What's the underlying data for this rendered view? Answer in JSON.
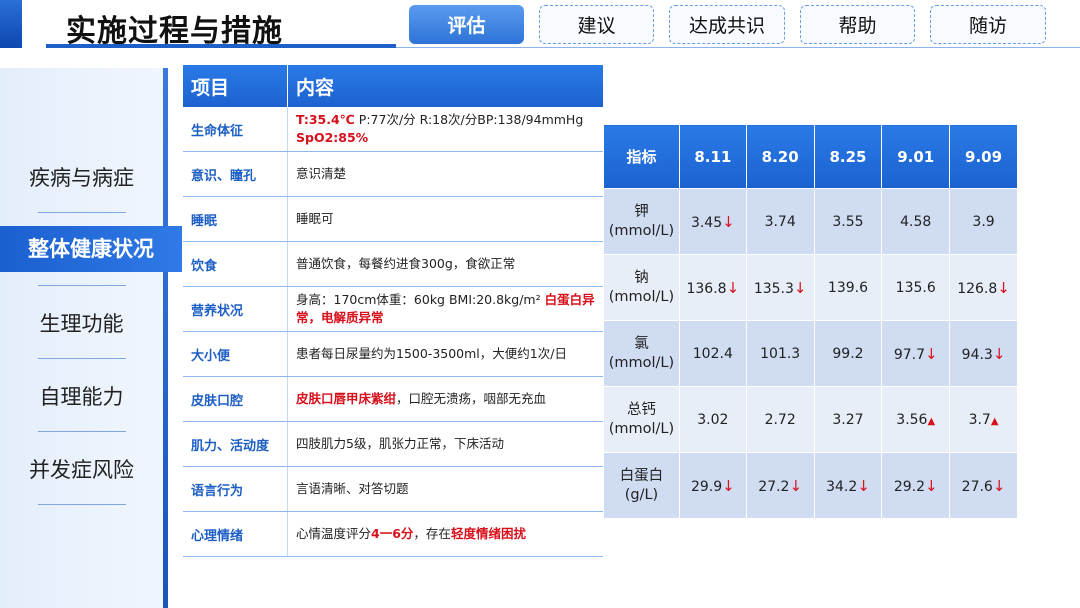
{
  "header": {
    "title": "实施过程与措施",
    "tabs": [
      "评估",
      "建议",
      "达成共识",
      "帮助",
      "随访"
    ],
    "active_tab": "评估"
  },
  "sidebar": {
    "items": [
      "疾病与病症",
      "整体健康状况",
      "生理功能",
      "自理能力",
      "并发症风险"
    ],
    "active_item": "整体健康状况"
  },
  "left_table": {
    "headers": [
      "项目",
      "内容"
    ],
    "rows": [
      {
        "label": "生命体征",
        "parts": [
          {
            "t": "T:35.4℃",
            "r": true
          },
          {
            "t": " P:77次/分 R:18次/分BP:138/94mmHg ",
            "r": false
          },
          {
            "t": "SpO2:85%",
            "r": true
          }
        ]
      },
      {
        "label": "意识、瞳孔",
        "parts": [
          {
            "t": "意识清楚",
            "r": false
          }
        ]
      },
      {
        "label": "睡眠",
        "parts": [
          {
            "t": "睡眠可",
            "r": false
          }
        ]
      },
      {
        "label": "饮食",
        "parts": [
          {
            "t": "普通饮食，每餐约进食300g，食欲正常",
            "r": false
          }
        ]
      },
      {
        "label": "营养状况",
        "parts": [
          {
            "t": "身高：170cm体重：60kg BMI:20.8kg/m² ",
            "r": false
          },
          {
            "t": "白蛋白异常，电解质异常",
            "r": true
          }
        ]
      },
      {
        "label": "大小便",
        "parts": [
          {
            "t": "患者每日尿量约为1500-3500ml，大便约1次/日",
            "r": false
          }
        ]
      },
      {
        "label": "皮肤口腔",
        "parts": [
          {
            "t": "皮肤口唇甲床紫绀",
            "r": true
          },
          {
            "t": "，口腔无溃疡，咽部无充血",
            "r": false
          }
        ]
      },
      {
        "label": "肌力、活动度",
        "parts": [
          {
            "t": "四肢肌力5级，肌张力正常，下床活动",
            "r": false
          }
        ]
      },
      {
        "label": "语言行为",
        "parts": [
          {
            "t": "言语清晰、对答切题",
            "r": false
          }
        ]
      },
      {
        "label": "心理情绪",
        "parts": [
          {
            "t": "心情温度评分",
            "r": false
          },
          {
            "t": "4一6分",
            "r": true
          },
          {
            "t": "，存在",
            "r": false
          },
          {
            "t": "轻度情绪困扰",
            "r": true
          }
        ]
      }
    ]
  },
  "lab_table": {
    "headers": [
      "指标",
      "8.11",
      "8.20",
      "8.25",
      "9.01",
      "9.09"
    ],
    "rows": [
      {
        "name": "钾",
        "unit": "(mmol/L)",
        "cells": [
          {
            "v": "3.45",
            "f": "down"
          },
          {
            "v": "3.74",
            "f": ""
          },
          {
            "v": "3.55",
            "f": ""
          },
          {
            "v": "4.58",
            "f": ""
          },
          {
            "v": "3.9",
            "f": ""
          }
        ]
      },
      {
        "name": "钠",
        "unit": "(mmol/L)",
        "cells": [
          {
            "v": "136.8",
            "f": "down"
          },
          {
            "v": "135.3",
            "f": "down"
          },
          {
            "v": "139.6",
            "f": ""
          },
          {
            "v": "135.6",
            "f": ""
          },
          {
            "v": "126.8",
            "f": "down"
          }
        ]
      },
      {
        "name": "氯",
        "unit": "(mmol/L)",
        "cells": [
          {
            "v": "102.4",
            "f": ""
          },
          {
            "v": "101.3",
            "f": ""
          },
          {
            "v": "99.2",
            "f": ""
          },
          {
            "v": "97.7",
            "f": "down"
          },
          {
            "v": "94.3",
            "f": "down"
          }
        ]
      },
      {
        "name": "总钙",
        "unit": "(mmol/L)",
        "cells": [
          {
            "v": "3.02",
            "f": ""
          },
          {
            "v": "2.72",
            "f": ""
          },
          {
            "v": "3.27",
            "f": ""
          },
          {
            "v": "3.56",
            "f": "up"
          },
          {
            "v": "3.7",
            "f": "up"
          }
        ]
      },
      {
        "name": "白蛋白",
        "unit": "(g/L)",
        "cells": [
          {
            "v": "29.9",
            "f": "down"
          },
          {
            "v": "27.2",
            "f": "down"
          },
          {
            "v": "34.2",
            "f": "down"
          },
          {
            "v": "29.2",
            "f": "down"
          },
          {
            "v": "27.6",
            "f": "down"
          }
        ]
      }
    ],
    "flag_symbols": {
      "down": "↓",
      "up": "▲"
    }
  },
  "colors": {
    "brand_blue": "#1e5fc8",
    "alert_red": "#d8101b"
  }
}
